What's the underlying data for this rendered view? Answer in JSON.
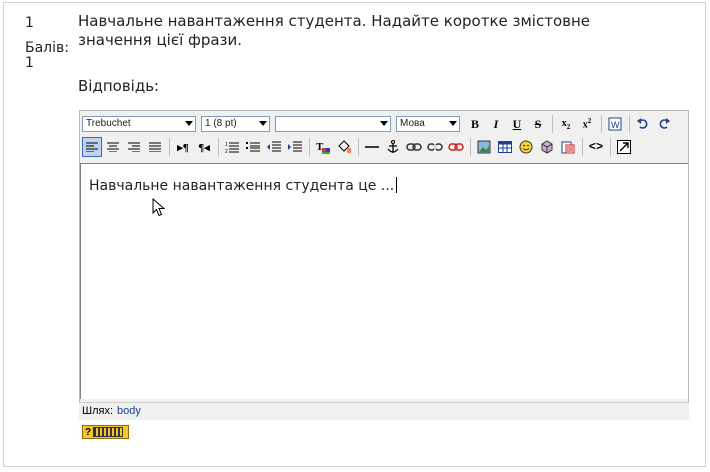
{
  "question": {
    "number": "1",
    "grade_label": "Балів:",
    "grade_value": "1",
    "text": "Навчальне навантаження студента. Надайте коротке змістовне значення цієї фрази.",
    "answer_label": "Відповідь:"
  },
  "toolbar": {
    "font_family": "Trebuchet",
    "font_size": "1 (8 pt)",
    "style_value": "",
    "language": "Мова",
    "bold": "B",
    "italic": "I",
    "underline": "U",
    "strike": "S"
  },
  "editor": {
    "content": "Навчальне навантаження студента це ..."
  },
  "statusbar": {
    "path_label": "Шлях:",
    "path_value": "body"
  },
  "badge": {
    "help": "?"
  },
  "colors": {
    "border": "#b8b8b8",
    "toolbar_bg": "#f0f0ee",
    "link": "#1a3c9a",
    "badge": "#f5c531"
  }
}
